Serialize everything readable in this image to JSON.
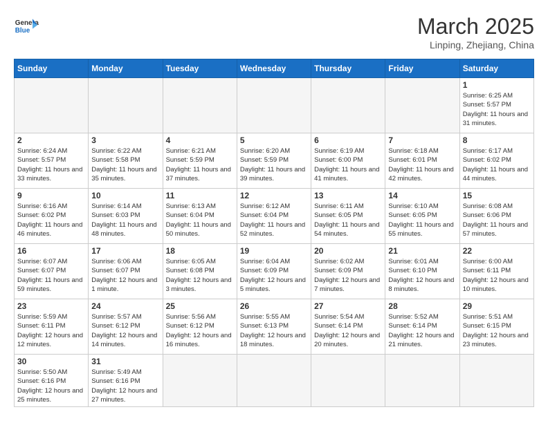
{
  "header": {
    "logo_general": "General",
    "logo_blue": "Blue",
    "month_title": "March 2025",
    "location": "Linping, Zhejiang, China"
  },
  "weekdays": [
    "Sunday",
    "Monday",
    "Tuesday",
    "Wednesday",
    "Thursday",
    "Friday",
    "Saturday"
  ],
  "days": [
    {
      "num": "",
      "info": ""
    },
    {
      "num": "",
      "info": ""
    },
    {
      "num": "",
      "info": ""
    },
    {
      "num": "",
      "info": ""
    },
    {
      "num": "",
      "info": ""
    },
    {
      "num": "",
      "info": ""
    },
    {
      "num": "1",
      "info": "Sunrise: 6:25 AM\nSunset: 5:57 PM\nDaylight: 11 hours and 31 minutes."
    },
    {
      "num": "2",
      "info": "Sunrise: 6:24 AM\nSunset: 5:57 PM\nDaylight: 11 hours and 33 minutes."
    },
    {
      "num": "3",
      "info": "Sunrise: 6:22 AM\nSunset: 5:58 PM\nDaylight: 11 hours and 35 minutes."
    },
    {
      "num": "4",
      "info": "Sunrise: 6:21 AM\nSunset: 5:59 PM\nDaylight: 11 hours and 37 minutes."
    },
    {
      "num": "5",
      "info": "Sunrise: 6:20 AM\nSunset: 5:59 PM\nDaylight: 11 hours and 39 minutes."
    },
    {
      "num": "6",
      "info": "Sunrise: 6:19 AM\nSunset: 6:00 PM\nDaylight: 11 hours and 41 minutes."
    },
    {
      "num": "7",
      "info": "Sunrise: 6:18 AM\nSunset: 6:01 PM\nDaylight: 11 hours and 42 minutes."
    },
    {
      "num": "8",
      "info": "Sunrise: 6:17 AM\nSunset: 6:02 PM\nDaylight: 11 hours and 44 minutes."
    },
    {
      "num": "9",
      "info": "Sunrise: 6:16 AM\nSunset: 6:02 PM\nDaylight: 11 hours and 46 minutes."
    },
    {
      "num": "10",
      "info": "Sunrise: 6:14 AM\nSunset: 6:03 PM\nDaylight: 11 hours and 48 minutes."
    },
    {
      "num": "11",
      "info": "Sunrise: 6:13 AM\nSunset: 6:04 PM\nDaylight: 11 hours and 50 minutes."
    },
    {
      "num": "12",
      "info": "Sunrise: 6:12 AM\nSunset: 6:04 PM\nDaylight: 11 hours and 52 minutes."
    },
    {
      "num": "13",
      "info": "Sunrise: 6:11 AM\nSunset: 6:05 PM\nDaylight: 11 hours and 54 minutes."
    },
    {
      "num": "14",
      "info": "Sunrise: 6:10 AM\nSunset: 6:05 PM\nDaylight: 11 hours and 55 minutes."
    },
    {
      "num": "15",
      "info": "Sunrise: 6:08 AM\nSunset: 6:06 PM\nDaylight: 11 hours and 57 minutes."
    },
    {
      "num": "16",
      "info": "Sunrise: 6:07 AM\nSunset: 6:07 PM\nDaylight: 11 hours and 59 minutes."
    },
    {
      "num": "17",
      "info": "Sunrise: 6:06 AM\nSunset: 6:07 PM\nDaylight: 12 hours and 1 minute."
    },
    {
      "num": "18",
      "info": "Sunrise: 6:05 AM\nSunset: 6:08 PM\nDaylight: 12 hours and 3 minutes."
    },
    {
      "num": "19",
      "info": "Sunrise: 6:04 AM\nSunset: 6:09 PM\nDaylight: 12 hours and 5 minutes."
    },
    {
      "num": "20",
      "info": "Sunrise: 6:02 AM\nSunset: 6:09 PM\nDaylight: 12 hours and 7 minutes."
    },
    {
      "num": "21",
      "info": "Sunrise: 6:01 AM\nSunset: 6:10 PM\nDaylight: 12 hours and 8 minutes."
    },
    {
      "num": "22",
      "info": "Sunrise: 6:00 AM\nSunset: 6:11 PM\nDaylight: 12 hours and 10 minutes."
    },
    {
      "num": "23",
      "info": "Sunrise: 5:59 AM\nSunset: 6:11 PM\nDaylight: 12 hours and 12 minutes."
    },
    {
      "num": "24",
      "info": "Sunrise: 5:57 AM\nSunset: 6:12 PM\nDaylight: 12 hours and 14 minutes."
    },
    {
      "num": "25",
      "info": "Sunrise: 5:56 AM\nSunset: 6:12 PM\nDaylight: 12 hours and 16 minutes."
    },
    {
      "num": "26",
      "info": "Sunrise: 5:55 AM\nSunset: 6:13 PM\nDaylight: 12 hours and 18 minutes."
    },
    {
      "num": "27",
      "info": "Sunrise: 5:54 AM\nSunset: 6:14 PM\nDaylight: 12 hours and 20 minutes."
    },
    {
      "num": "28",
      "info": "Sunrise: 5:52 AM\nSunset: 6:14 PM\nDaylight: 12 hours and 21 minutes."
    },
    {
      "num": "29",
      "info": "Sunrise: 5:51 AM\nSunset: 6:15 PM\nDaylight: 12 hours and 23 minutes."
    },
    {
      "num": "30",
      "info": "Sunrise: 5:50 AM\nSunset: 6:16 PM\nDaylight: 12 hours and 25 minutes."
    },
    {
      "num": "31",
      "info": "Sunrise: 5:49 AM\nSunset: 6:16 PM\nDaylight: 12 hours and 27 minutes."
    },
    {
      "num": "",
      "info": ""
    },
    {
      "num": "",
      "info": ""
    },
    {
      "num": "",
      "info": ""
    },
    {
      "num": "",
      "info": ""
    },
    {
      "num": "",
      "info": ""
    }
  ]
}
